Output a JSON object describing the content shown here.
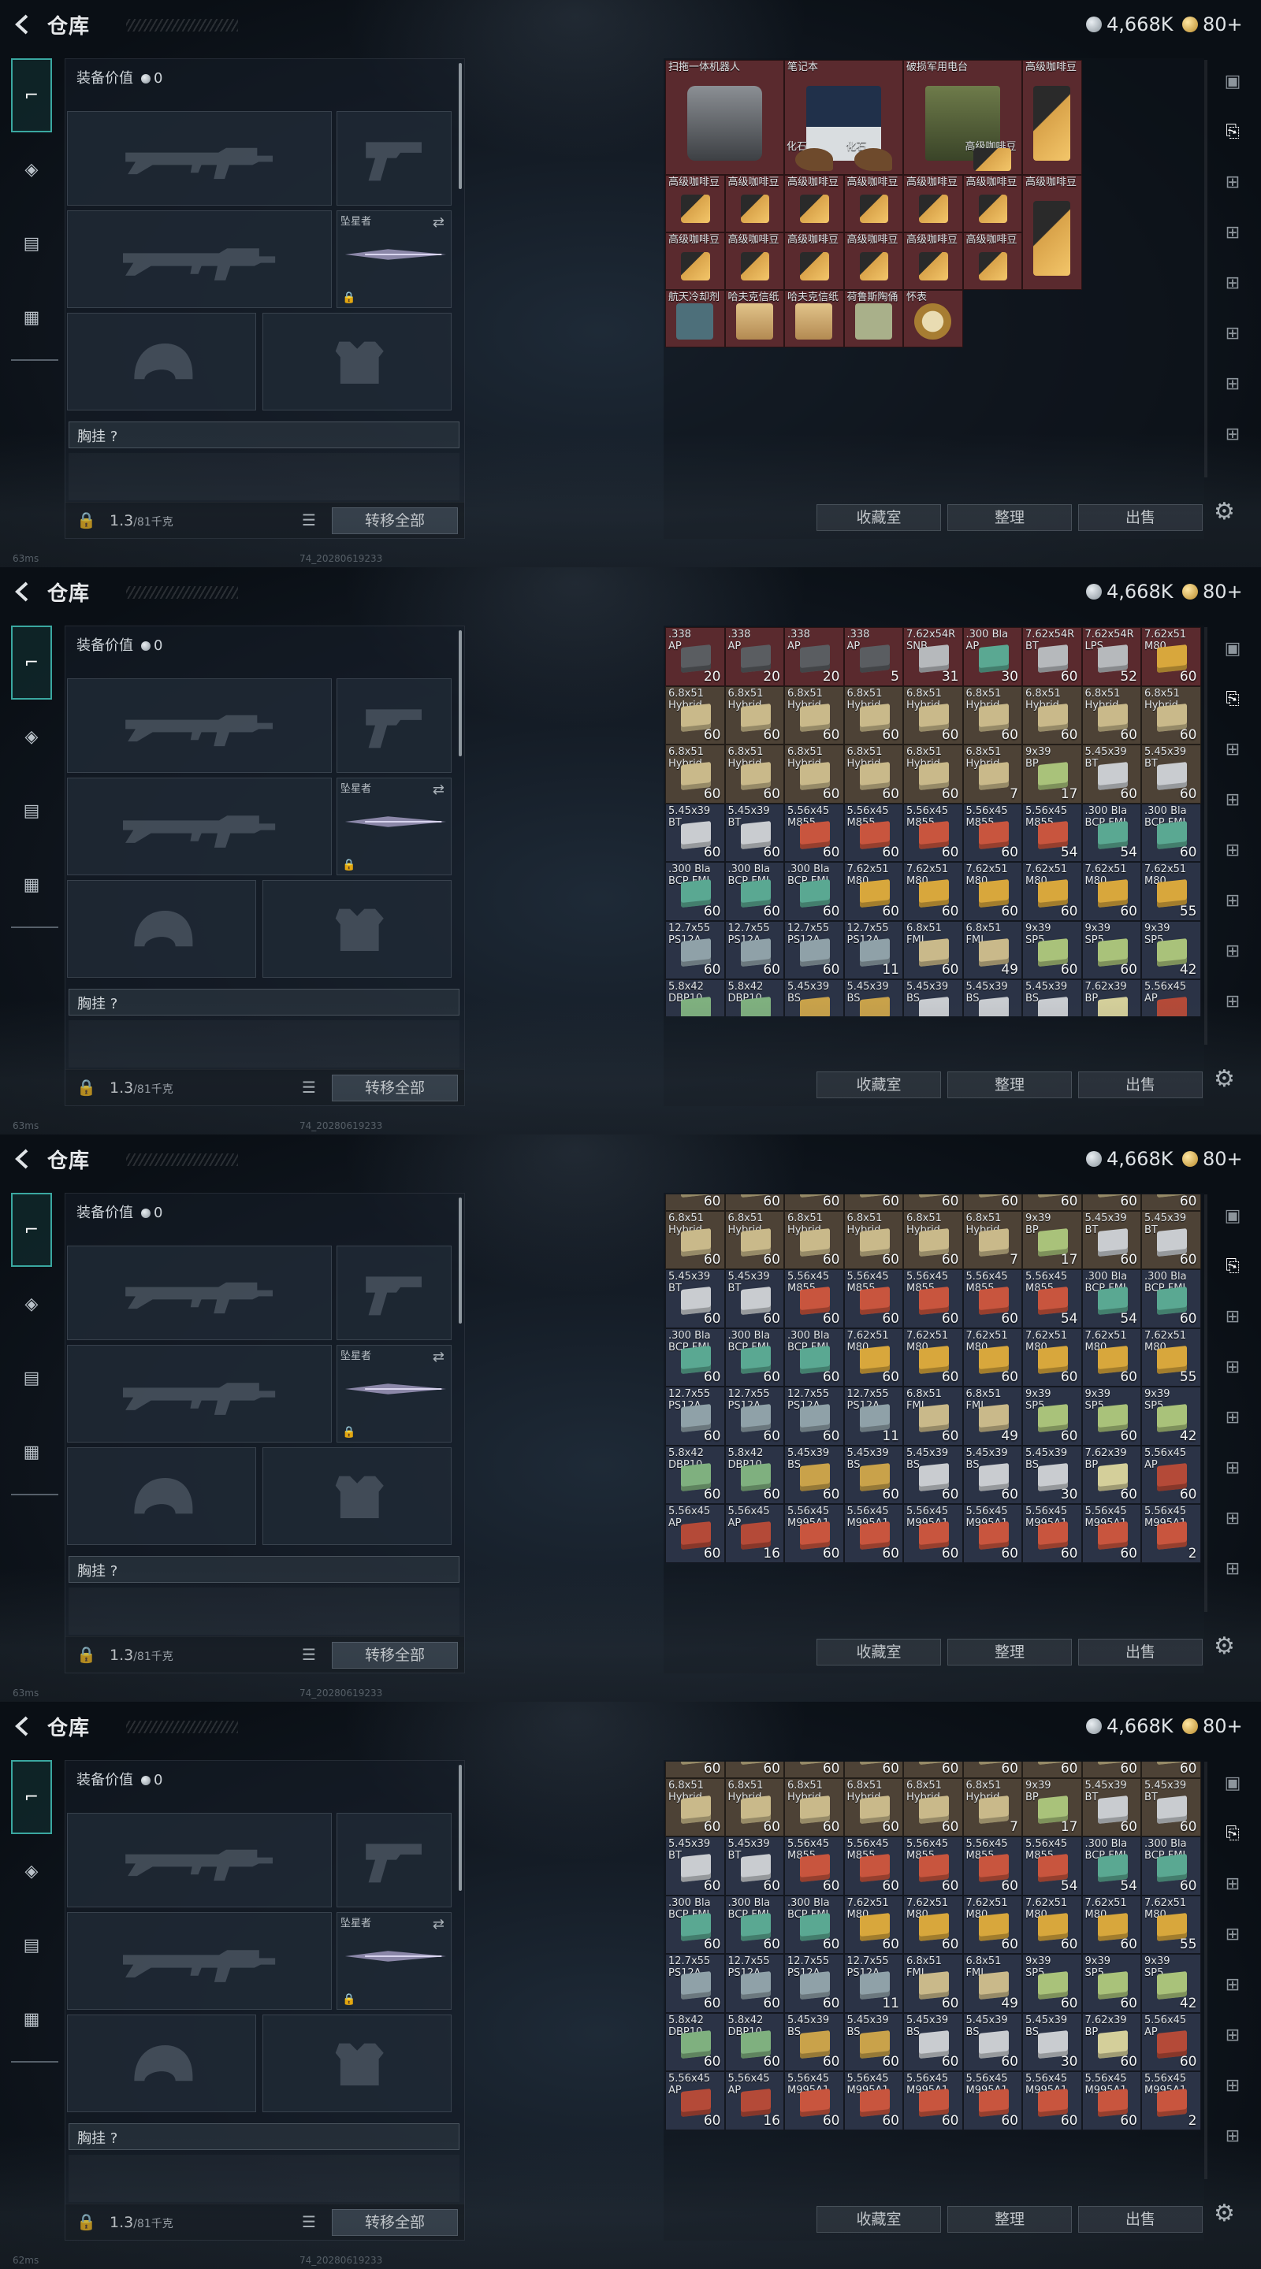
{
  "screens": [
    {
      "id": "s1",
      "ping": "63ms",
      "grid": "gear"
    },
    {
      "id": "s2",
      "ping": "63ms",
      "grid": "ammo_top"
    },
    {
      "id": "s3",
      "ping": "63ms",
      "grid": "ammo_scrolled"
    },
    {
      "id": "s4",
      "ping": "62ms",
      "grid": "ammo_scrolled"
    }
  ],
  "header": {
    "title": "仓库",
    "silver": "4,668K",
    "gold": "80+"
  },
  "left_tabs": [
    "pistol-tab",
    "armor-tab",
    "vest-tab",
    "backpack-tab"
  ],
  "equipment": {
    "value_label": "装备价值",
    "value": "0",
    "knife_label": "坠星者",
    "chest_label": "胸挂 ?",
    "weight": "1.3",
    "weight_max": "/81千克",
    "move_all": "转移全部"
  },
  "actions": {
    "collection": "收藏室",
    "sort": "整理",
    "sell": "出售"
  },
  "build_id": "74_20280619233",
  "gear_items": [
    {
      "name": "扫拖一体机器人",
      "color": "#6b6f74",
      "shape": "robot"
    },
    {
      "name": "笔记本",
      "color": "#cfd4d8",
      "shape": "laptop"
    },
    {
      "name": "破损军用电台",
      "color": "#5a6a3e",
      "shape": "radio"
    },
    {
      "name": "高级咖啡豆",
      "color": "#caa24a",
      "shape": "bag"
    },
    {
      "name": "化石",
      "color": "#7a5233",
      "shape": "fossil"
    },
    {
      "name": "化石",
      "color": "#7a5233",
      "shape": "fossil"
    },
    {
      "name": "高级咖啡豆",
      "color": "#caa24a",
      "shape": "bag"
    },
    {
      "name": "高级咖啡豆",
      "color": "#caa24a",
      "shape": "bag"
    },
    {
      "name": "航天冷却剂",
      "color": "#4d6f7a",
      "shape": "cooler"
    },
    {
      "name": "哈夫克信纸",
      "color": "#c9a56a",
      "shape": "paper"
    },
    {
      "name": "哈夫克信纸",
      "color": "#c9a56a",
      "shape": "paper"
    },
    {
      "name": "荷鲁斯陶俑",
      "color": "#a9b08a",
      "shape": "figure"
    },
    {
      "name": "怀表",
      "color": "#b08a3e",
      "shape": "watch"
    }
  ],
  "ammo_top": [
    [
      ".338\nAP",
      "20",
      "#5a5d61",
      "red"
    ],
    [
      ".338\nAP",
      "20",
      "#5a5d61",
      "red"
    ],
    [
      ".338\nAP",
      "20",
      "#5a5d61",
      "red"
    ],
    [
      ".338\nAP",
      "5",
      "#5a5d61",
      "red"
    ],
    [
      "7.62x54R\nSNB",
      "31",
      "#b6b9bc",
      "red"
    ],
    [
      ".300 Bla\nAP",
      "30",
      "#5aa892",
      "red"
    ],
    [
      "7.62x54R\nBT",
      "60",
      "#b6b9bc",
      "red"
    ],
    [
      "7.62x54R\nLPS",
      "52",
      "#b6b9bc",
      "red"
    ],
    [
      "7.62x51\nM80",
      "60",
      "#d8a73c",
      "red"
    ],
    [
      "6.8x51\nHybrid",
      "60",
      "#c9b98a",
      "tan"
    ],
    [
      "6.8x51\nHybrid",
      "60",
      "#c9b98a",
      "tan"
    ],
    [
      "6.8x51\nHybrid",
      "60",
      "#c9b98a",
      "tan"
    ],
    [
      "6.8x51\nHybrid",
      "60",
      "#c9b98a",
      "tan"
    ],
    [
      "6.8x51\nHybrid",
      "60",
      "#c9b98a",
      "tan"
    ],
    [
      "6.8x51\nHybrid",
      "60",
      "#c9b98a",
      "tan"
    ],
    [
      "6.8x51\nHybrid",
      "60",
      "#c9b98a",
      "tan"
    ],
    [
      "6.8x51\nHybrid",
      "60",
      "#c9b98a",
      "tan"
    ],
    [
      "6.8x51\nHybrid",
      "60",
      "#c9b98a",
      "tan"
    ],
    [
      "6.8x51\nHybrid",
      "60",
      "#c9b98a",
      "tan"
    ],
    [
      "6.8x51\nHybrid",
      "60",
      "#c9b98a",
      "tan"
    ],
    [
      "6.8x51\nHybrid",
      "60",
      "#c9b98a",
      "tan"
    ],
    [
      "6.8x51\nHybrid",
      "60",
      "#c9b98a",
      "tan"
    ],
    [
      "6.8x51\nHybrid",
      "60",
      "#c9b98a",
      "tan"
    ],
    [
      "6.8x51\nHybrid",
      "7",
      "#c9b98a",
      "tan"
    ],
    [
      "9x39\nBP",
      "17",
      "#a9c27a",
      "tan"
    ],
    [
      "5.45x39\nBT",
      "60",
      "#c9ccd0",
      "tan"
    ],
    [
      "5.45x39\nBT",
      "60",
      "#c9ccd0",
      "tan"
    ],
    [
      "5.45x39\nBT",
      "60",
      "#c9ccd0",
      "blue"
    ],
    [
      "5.45x39\nBT",
      "60",
      "#c9ccd0",
      "blue"
    ],
    [
      "5.56x45\nM855",
      "60",
      "#c8553e",
      "blue"
    ],
    [
      "5.56x45\nM855",
      "60",
      "#c8553e",
      "blue"
    ],
    [
      "5.56x45\nM855",
      "60",
      "#c8553e",
      "blue"
    ],
    [
      "5.56x45\nM855",
      "60",
      "#c8553e",
      "blue"
    ],
    [
      "5.56x45\nM855",
      "54",
      "#c8553e",
      "blue"
    ],
    [
      ".300 Bla\nBCP FMJ",
      "54",
      "#5aa892",
      "blue"
    ],
    [
      ".300 Bla\nBCP FMJ",
      "60",
      "#5aa892",
      "blue"
    ],
    [
      ".300 Bla\nBCP FMJ",
      "60",
      "#5aa892",
      "blue"
    ],
    [
      ".300 Bla\nBCP FMJ",
      "60",
      "#5aa892",
      "blue"
    ],
    [
      ".300 Bla\nBCP FMJ",
      "60",
      "#5aa892",
      "blue"
    ],
    [
      "7.62x51\nM80",
      "60",
      "#d8a73c",
      "blue"
    ],
    [
      "7.62x51\nM80",
      "60",
      "#d8a73c",
      "blue"
    ],
    [
      "7.62x51\nM80",
      "60",
      "#d8a73c",
      "blue"
    ],
    [
      "7.62x51\nM80",
      "60",
      "#d8a73c",
      "blue"
    ],
    [
      "7.62x51\nM80",
      "60",
      "#d8a73c",
      "blue"
    ],
    [
      "7.62x51\nM80",
      "55",
      "#d8a73c",
      "blue"
    ],
    [
      "12.7x55\nPS12A",
      "60",
      "#8fa1a8",
      "blue"
    ],
    [
      "12.7x55\nPS12A",
      "60",
      "#8fa1a8",
      "blue"
    ],
    [
      "12.7x55\nPS12A",
      "60",
      "#8fa1a8",
      "blue"
    ],
    [
      "12.7x55\nPS12A",
      "11",
      "#8fa1a8",
      "blue"
    ],
    [
      "6.8x51\nFMJ",
      "60",
      "#c9b98a",
      "blue"
    ],
    [
      "6.8x51\nFMJ",
      "49",
      "#c9b98a",
      "blue"
    ],
    [
      "9x39\nSP5",
      "60",
      "#a9c27a",
      "blue"
    ],
    [
      "9x39\nSP5",
      "60",
      "#a9c27a",
      "blue"
    ],
    [
      "9x39\nSP5",
      "42",
      "#a9c27a",
      "blue"
    ],
    [
      "5.8x42\nDBP10",
      "60",
      "#7fb07f",
      "blue"
    ],
    [
      "5.8x42\nDBP10",
      "60",
      "#7fb07f",
      "blue"
    ],
    [
      "5.45x39\nBS",
      "60",
      "#c9a24a",
      "blue"
    ],
    [
      "5.45x39\nBS",
      "60",
      "#c9a24a",
      "blue"
    ],
    [
      "5.45x39\nBS",
      "60",
      "#c9ccd0",
      "blue"
    ],
    [
      "5.45x39\nBS",
      "60",
      "#c9ccd0",
      "blue"
    ],
    [
      "5.45x39\nBS",
      "30",
      "#c9ccd0",
      "blue"
    ],
    [
      "7.62x39\nBP",
      "60",
      "#d4cf9a",
      "blue"
    ],
    [
      "5.56x45\nAP",
      "60",
      "#b44a38",
      "blue"
    ],
    [
      "5.56x45\nAP",
      "60",
      "#b44a38",
      "blue"
    ],
    [
      "5.56x45\nAP",
      "60",
      "#b44a38",
      "blue"
    ],
    [
      "5.56x45\nM995A1",
      "60",
      "#c8553e",
      "blue"
    ],
    [
      "5.56x45\nM995A1",
      "60",
      "#c8553e",
      "blue"
    ],
    [
      "5.56x45\nM995A1",
      "60",
      "#c8553e",
      "blue"
    ],
    [
      "5.56x45\nM995A1",
      "60",
      "#c8553e",
      "blue"
    ],
    [
      "5.56x45\nM995A1",
      "60",
      "#c8553e",
      "blue"
    ],
    [
      "5.56x45\nM995A1",
      "60",
      "#c8553e",
      "blue"
    ],
    [
      "5.56x45\nM995A1",
      "60",
      "#c8553e",
      "blue"
    ]
  ],
  "ammo_scrolled": [
    [
      "",
      "60",
      "#c9b98a",
      "tan"
    ],
    [
      "",
      "60",
      "#c9b98a",
      "tan"
    ],
    [
      "",
      "60",
      "#c9b98a",
      "tan"
    ],
    [
      "",
      "60",
      "#c9b98a",
      "tan"
    ],
    [
      "",
      "60",
      "#c9b98a",
      "tan"
    ],
    [
      "",
      "60",
      "#c9b98a",
      "tan"
    ],
    [
      "",
      "60",
      "#c9b98a",
      "tan"
    ],
    [
      "",
      "60",
      "#c9b98a",
      "tan"
    ],
    [
      "",
      "60",
      "#c9b98a",
      "tan"
    ],
    [
      "6.8x51\nHybrid",
      "60",
      "#c9b98a",
      "tan"
    ],
    [
      "6.8x51\nHybrid",
      "60",
      "#c9b98a",
      "tan"
    ],
    [
      "6.8x51\nHybrid",
      "60",
      "#c9b98a",
      "tan"
    ],
    [
      "6.8x51\nHybrid",
      "60",
      "#c9b98a",
      "tan"
    ],
    [
      "6.8x51\nHybrid",
      "60",
      "#c9b98a",
      "tan"
    ],
    [
      "6.8x51\nHybrid",
      "7",
      "#c9b98a",
      "tan"
    ],
    [
      "9x39\nBP",
      "17",
      "#a9c27a",
      "tan"
    ],
    [
      "5.45x39\nBT",
      "60",
      "#c9ccd0",
      "tan"
    ],
    [
      "5.45x39\nBT",
      "60",
      "#c9ccd0",
      "tan"
    ],
    [
      "5.45x39\nBT",
      "60",
      "#c9ccd0",
      "blue"
    ],
    [
      "5.45x39\nBT",
      "60",
      "#c9ccd0",
      "blue"
    ],
    [
      "5.56x45\nM855",
      "60",
      "#c8553e",
      "blue"
    ],
    [
      "5.56x45\nM855",
      "60",
      "#c8553e",
      "blue"
    ],
    [
      "5.56x45\nM855",
      "60",
      "#c8553e",
      "blue"
    ],
    [
      "5.56x45\nM855",
      "60",
      "#c8553e",
      "blue"
    ],
    [
      "5.56x45\nM855",
      "54",
      "#c8553e",
      "blue"
    ],
    [
      ".300 Bla\nBCP FMJ",
      "54",
      "#5aa892",
      "blue"
    ],
    [
      ".300 Bla\nBCP FMJ",
      "60",
      "#5aa892",
      "blue"
    ],
    [
      ".300 Bla\nBCP FMJ",
      "60",
      "#5aa892",
      "blue"
    ],
    [
      ".300 Bla\nBCP FMJ",
      "60",
      "#5aa892",
      "blue"
    ],
    [
      ".300 Bla\nBCP FMJ",
      "60",
      "#5aa892",
      "blue"
    ],
    [
      "7.62x51\nM80",
      "60",
      "#d8a73c",
      "blue"
    ],
    [
      "7.62x51\nM80",
      "60",
      "#d8a73c",
      "blue"
    ],
    [
      "7.62x51\nM80",
      "60",
      "#d8a73c",
      "blue"
    ],
    [
      "7.62x51\nM80",
      "60",
      "#d8a73c",
      "blue"
    ],
    [
      "7.62x51\nM80",
      "60",
      "#d8a73c",
      "blue"
    ],
    [
      "7.62x51\nM80",
      "55",
      "#d8a73c",
      "blue"
    ],
    [
      "12.7x55\nPS12A",
      "60",
      "#8fa1a8",
      "blue"
    ],
    [
      "12.7x55\nPS12A",
      "60",
      "#8fa1a8",
      "blue"
    ],
    [
      "12.7x55\nPS12A",
      "60",
      "#8fa1a8",
      "blue"
    ],
    [
      "12.7x55\nPS12A",
      "11",
      "#8fa1a8",
      "blue"
    ],
    [
      "6.8x51\nFMJ",
      "60",
      "#c9b98a",
      "blue"
    ],
    [
      "6.8x51\nFMJ",
      "49",
      "#c9b98a",
      "blue"
    ],
    [
      "9x39\nSP5",
      "60",
      "#a9c27a",
      "blue"
    ],
    [
      "9x39\nSP5",
      "60",
      "#a9c27a",
      "blue"
    ],
    [
      "9x39\nSP5",
      "42",
      "#a9c27a",
      "blue"
    ],
    [
      "5.8x42\nDBP10",
      "60",
      "#7fb07f",
      "blue"
    ],
    [
      "5.8x42\nDBP10",
      "60",
      "#7fb07f",
      "blue"
    ],
    [
      "5.45x39\nBS",
      "60",
      "#c9a24a",
      "blue"
    ],
    [
      "5.45x39\nBS",
      "60",
      "#c9a24a",
      "blue"
    ],
    [
      "5.45x39\nBS",
      "60",
      "#c9ccd0",
      "blue"
    ],
    [
      "5.45x39\nBS",
      "60",
      "#c9ccd0",
      "blue"
    ],
    [
      "5.45x39\nBS",
      "30",
      "#c9ccd0",
      "blue"
    ],
    [
      "7.62x39\nBP",
      "60",
      "#d4cf9a",
      "blue"
    ],
    [
      "5.56x45\nAP",
      "60",
      "#b44a38",
      "blue"
    ],
    [
      "5.56x45\nAP",
      "60",
      "#b44a38",
      "blue"
    ],
    [
      "5.56x45\nAP",
      "16",
      "#b44a38",
      "blue"
    ],
    [
      "5.56x45\nM995A1",
      "60",
      "#c8553e",
      "blue"
    ],
    [
      "5.56x45\nM995A1",
      "60",
      "#c8553e",
      "blue"
    ],
    [
      "5.56x45\nM995A1",
      "60",
      "#c8553e",
      "blue"
    ],
    [
      "5.56x45\nM995A1",
      "60",
      "#c8553e",
      "blue"
    ],
    [
      "5.56x45\nM995A1",
      "60",
      "#c8553e",
      "blue"
    ],
    [
      "5.56x45\nM995A1",
      "60",
      "#c8553e",
      "blue"
    ],
    [
      "5.56x45\nM995A1",
      "2",
      "#c8553e",
      "blue"
    ]
  ],
  "tints": {
    "red": "#5a2a2e",
    "tan": "#4d4236",
    "blue": "#2b3346"
  }
}
